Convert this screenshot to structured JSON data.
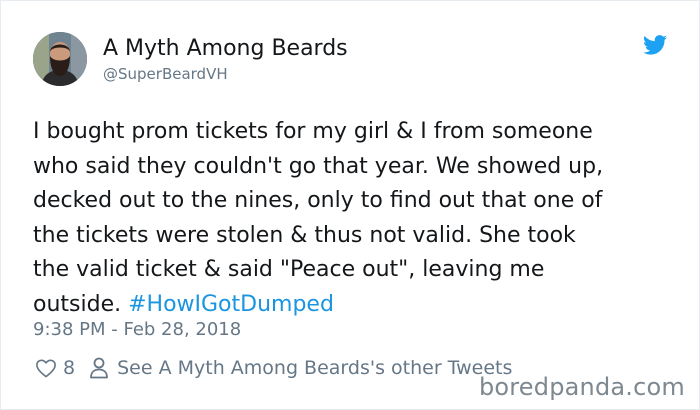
{
  "author": {
    "display_name": "A Myth Among Beards",
    "handle": "@SuperBeardVH",
    "avatar_icon": "bearded-man-avatar"
  },
  "tweet": {
    "text": "I bought prom tickets for my girl & I from someone\nwho said they couldn't go that year. We showed up,\ndecked out to the nines, only to find out that one of\nthe tickets were stolen & thus not valid. She took\nthe valid ticket & said \"Peace out\", leaving me\noutside. ",
    "hashtag": "#HowIGotDumped",
    "timestamp": "9:38 PM - Feb 28, 2018"
  },
  "actions": {
    "like_icon": "heart-icon",
    "like_count": "8",
    "profile_icon": "person-icon",
    "other_tweets_label": "See A Myth Among Beards's other Tweets"
  },
  "brand": {
    "platform_icon": "twitter-bird-icon",
    "watermark": "boredpanda.com"
  },
  "colors": {
    "accent": "#1b95e0",
    "secondary_text": "#657786",
    "primary_text": "#14171a"
  }
}
